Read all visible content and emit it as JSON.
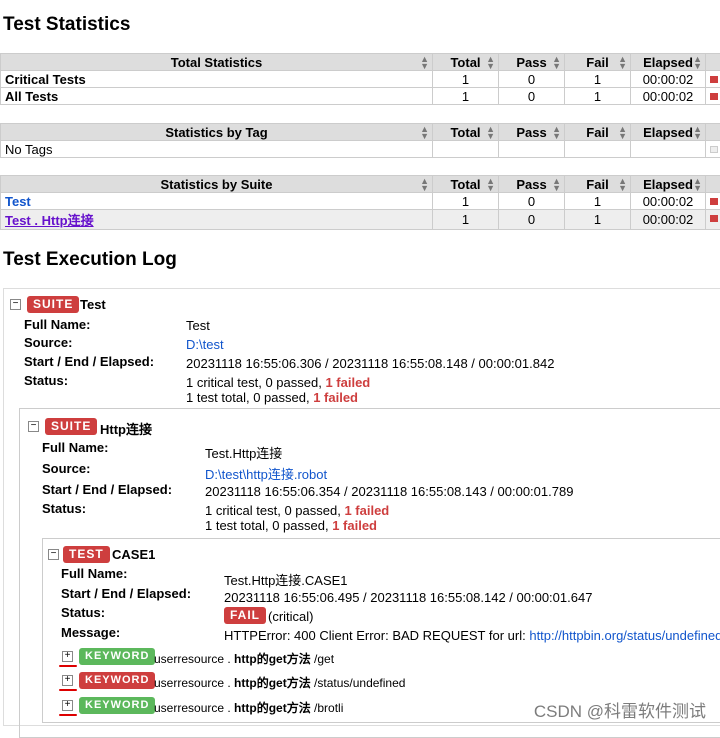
{
  "headings": {
    "test_statistics": "Test Statistics",
    "execution_log": "Test Execution Log"
  },
  "columns": {
    "total": "Total",
    "pass": "Pass",
    "fail": "Fail",
    "elapsed": "Elapsed"
  },
  "total_statistics": {
    "header": "Total Statistics",
    "rows": [
      {
        "name": "Critical Tests",
        "total": "1",
        "pass": "0",
        "fail": "1",
        "elapsed": "00:00:02"
      },
      {
        "name": "All Tests",
        "total": "1",
        "pass": "0",
        "fail": "1",
        "elapsed": "00:00:02"
      }
    ]
  },
  "tag_statistics": {
    "header": "Statistics by Tag",
    "empty": "No Tags"
  },
  "suite_statistics": {
    "header": "Statistics by Suite",
    "rows": [
      {
        "name": "Test",
        "total": "1",
        "pass": "0",
        "fail": "1",
        "elapsed": "00:00:02"
      },
      {
        "name": "Test . Http连接",
        "total": "1",
        "pass": "0",
        "fail": "1",
        "elapsed": "00:00:02"
      }
    ]
  },
  "labels": {
    "suite": "SUITE",
    "test": "TEST",
    "keyword": "KEYWORD",
    "full_name": "Full Name:",
    "source": "Source:",
    "start_end": "Start / End / Elapsed:",
    "status": "Status:",
    "message": "Message:"
  },
  "suite1": {
    "name": "Test",
    "full_name": "Test",
    "source": "D:\\test",
    "times": "20231118 16:55:06.306 / 20231118 16:55:08.148 / 00:00:01.842",
    "status_line1_a": "1 critical test, 0 passed, ",
    "status_line1_b": "1 failed",
    "status_line2_a": "1 test total, 0 passed, ",
    "status_line2_b": "1 failed"
  },
  "suite2": {
    "name": "Http连接",
    "full_name": "Test.Http连接",
    "source": "D:\\test\\http连接.robot",
    "times": "20231118 16:55:06.354 / 20231118 16:55:08.143 / 00:00:01.789",
    "status_line1_a": "1 critical test, 0 passed, ",
    "status_line1_b": "1 failed",
    "status_line2_a": "1 test total, 0 passed, ",
    "status_line2_b": "1 failed"
  },
  "test1": {
    "name": "CASE1",
    "full_name": "Test.Http连接.CASE1",
    "times": "20231118 16:55:06.495 / 20231118 16:55:08.142 / 00:00:01.647",
    "status_badge": "FAIL",
    "status_note": "(critical)",
    "message_a": "HTTPError: 400 Client Error: BAD REQUEST for url: ",
    "message_url": "http://httpbin.org/status/undefined"
  },
  "keywords": [
    {
      "label": "KEYWORD",
      "color": "green",
      "lib": "userresource . ",
      "name": "http的get方法",
      "arg": " /get"
    },
    {
      "label": "KEYWORD",
      "color": "red",
      "lib": "userresource . ",
      "name": "http的get方法",
      "arg": " /status/undefined"
    },
    {
      "label": "KEYWORD",
      "color": "green",
      "lib": "userresource . ",
      "name": "http的get方法",
      "arg": " /brotli"
    }
  ],
  "watermark": "CSDN @科雷软件测试",
  "colors": {
    "fail": "#ce3e3e",
    "pass": "#5cb85c",
    "link": "#1155cc",
    "header": "#dddddd"
  },
  "icons": {
    "sort": "sort-icon",
    "toggle": "minus-icon",
    "expand": "plus-icon"
  }
}
